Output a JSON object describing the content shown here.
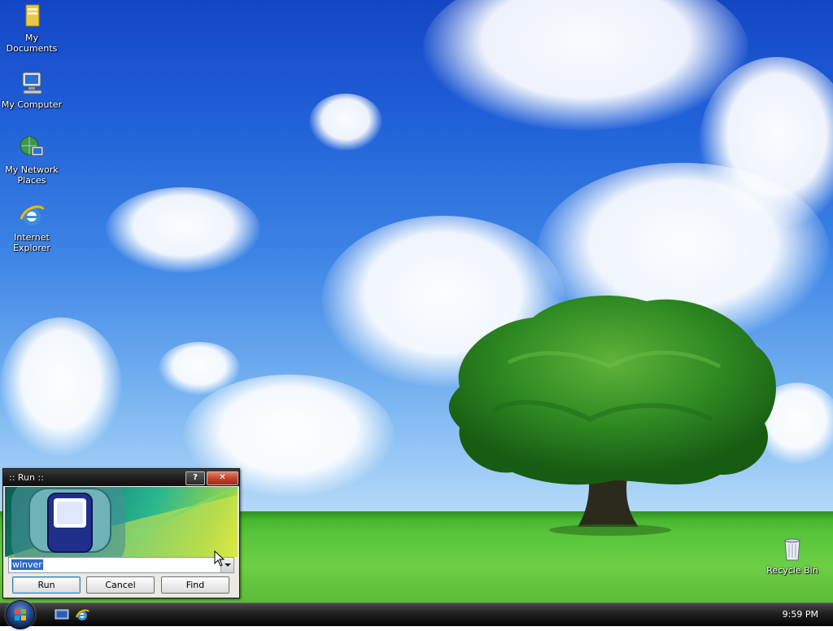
{
  "desktop": {
    "icons": [
      {
        "label": "My Documents"
      },
      {
        "label": "My Computer"
      },
      {
        "label": "My Network Places"
      },
      {
        "label": "Internet Explorer"
      },
      {
        "label": "Recycle Bin"
      }
    ]
  },
  "run_dialog": {
    "title": ":: Run ::",
    "help_label": "?",
    "close_label": "✕",
    "input_value": "winver",
    "buttons": {
      "run": "Run",
      "cancel": "Cancel",
      "find": "Find"
    }
  },
  "taskbar": {
    "clock": "9:59 PM"
  },
  "colors": {
    "sky_top": "#1446c4",
    "grass": "#58c53a",
    "selection": "#316ac5"
  }
}
